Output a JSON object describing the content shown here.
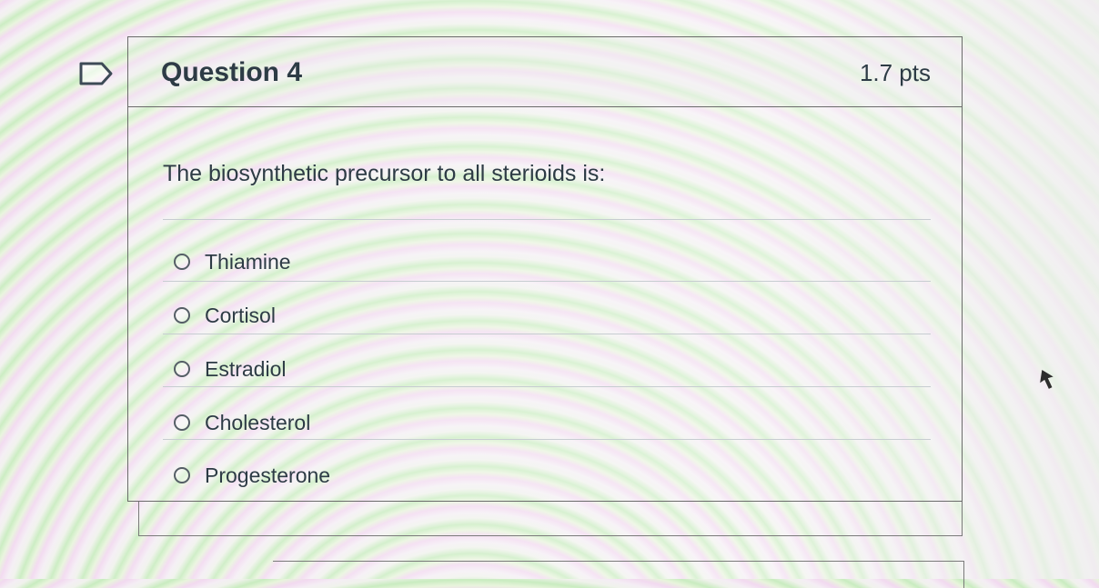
{
  "question": {
    "title": "Question 4",
    "points": "1.7 pts",
    "text": "The biosynthetic precursor to all sterioids is:",
    "flag_icon": "flag-outline-icon"
  },
  "answers": [
    {
      "label": "Thiamine",
      "selected": false
    },
    {
      "label": "Cortisol",
      "selected": false
    },
    {
      "label": "Estradiol",
      "selected": false
    },
    {
      "label": "Cholesterol",
      "selected": false
    },
    {
      "label": "Progesterone",
      "selected": false
    }
  ],
  "colors": {
    "text": "#2d3b45",
    "border": "#6b6b6b",
    "divider": "#c7cdd1"
  }
}
